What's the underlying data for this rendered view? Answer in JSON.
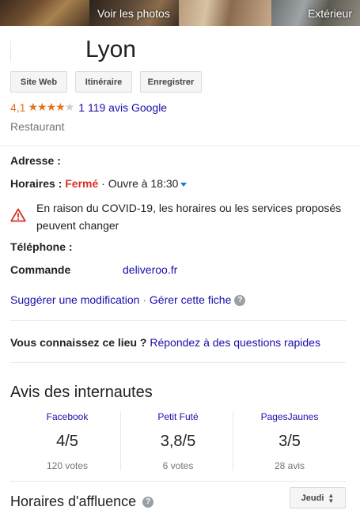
{
  "photos": {
    "see_photos": "Voir les photos",
    "exterior": "Extérieur"
  },
  "place": {
    "name": "Lyon",
    "category": "Restaurant",
    "rating": "4,1",
    "rating_value": 4.1,
    "reviews_text": "1 119 avis Google"
  },
  "actions": {
    "website": "Site Web",
    "directions": "Itinéraire",
    "save": "Enregistrer"
  },
  "info": {
    "address_label": "Adresse :",
    "hours_label": "Horaires :",
    "hours_status": "Fermé",
    "hours_sep": "·",
    "hours_next": "Ouvre à 18:30",
    "covid_notice": "En raison du COVID-19, les horaires ou les services proposés peuvent changer",
    "phone_label": "Téléphone :",
    "order_label": "Commande",
    "order_link": "deliveroo.fr"
  },
  "edit": {
    "suggest": "Suggérer une modification",
    "sep": "·",
    "manage": "Gérer cette fiche"
  },
  "quick": {
    "question": "Vous connaissez ce lieu ?",
    "answer_link": "Répondez à des questions rapides"
  },
  "web_reviews": {
    "title": "Avis des internautes",
    "sources": [
      {
        "name": "Facebook",
        "score": "4/5",
        "votes": "120 votes"
      },
      {
        "name": "Petit Futé",
        "score": "3,8/5",
        "votes": "6 votes"
      },
      {
        "name": "PagesJaunes",
        "score": "3/5",
        "votes": "28 avis"
      }
    ]
  },
  "busy": {
    "title": "Horaires d'affluence",
    "day": "Jeudi"
  },
  "colors": {
    "link": "#1a0dab",
    "rating": "#e7711b",
    "closed": "#d93025",
    "warning": "#d93025"
  },
  "icons": {
    "warning": "warning-triangle-icon",
    "help": "help-circle-icon",
    "caret": "caret-down-icon",
    "select": "updown-icon"
  }
}
